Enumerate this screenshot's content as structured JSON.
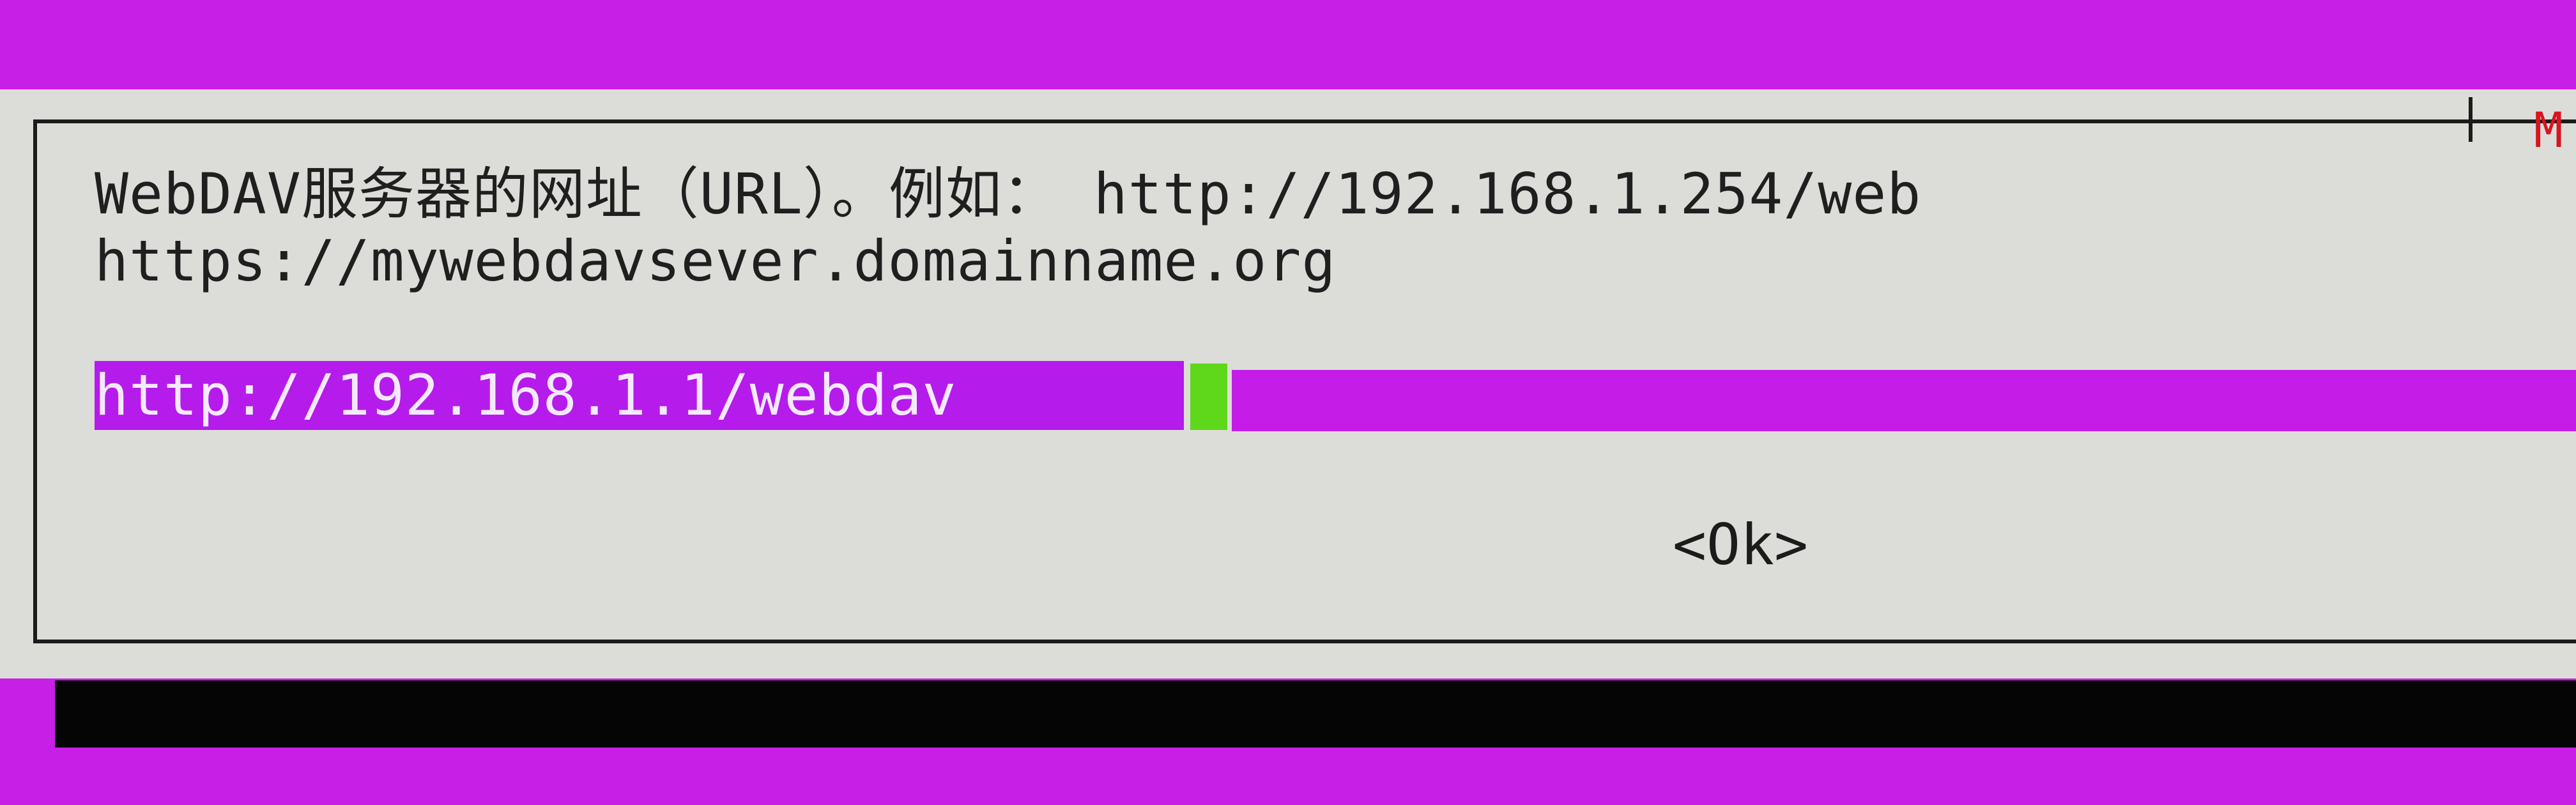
{
  "dialog": {
    "title_fragment": "M",
    "prompt_line_1": "WebDAV服务器的网址（URL）。例如： http://192.168.1.254/web",
    "prompt_line_2": "https://mywebdavsever.domainname.org"
  },
  "input": {
    "value": "http://192.168.1.1/webdav",
    "field_fill": "________________________________________"
  },
  "buttons": {
    "ok": "<Ok>"
  },
  "colors": {
    "background": "#c81fe6",
    "dialog": "#dcddd9",
    "input_highlight": "#b51bea",
    "cursor": "#5fd71a",
    "title_accent": "#d8141f"
  }
}
